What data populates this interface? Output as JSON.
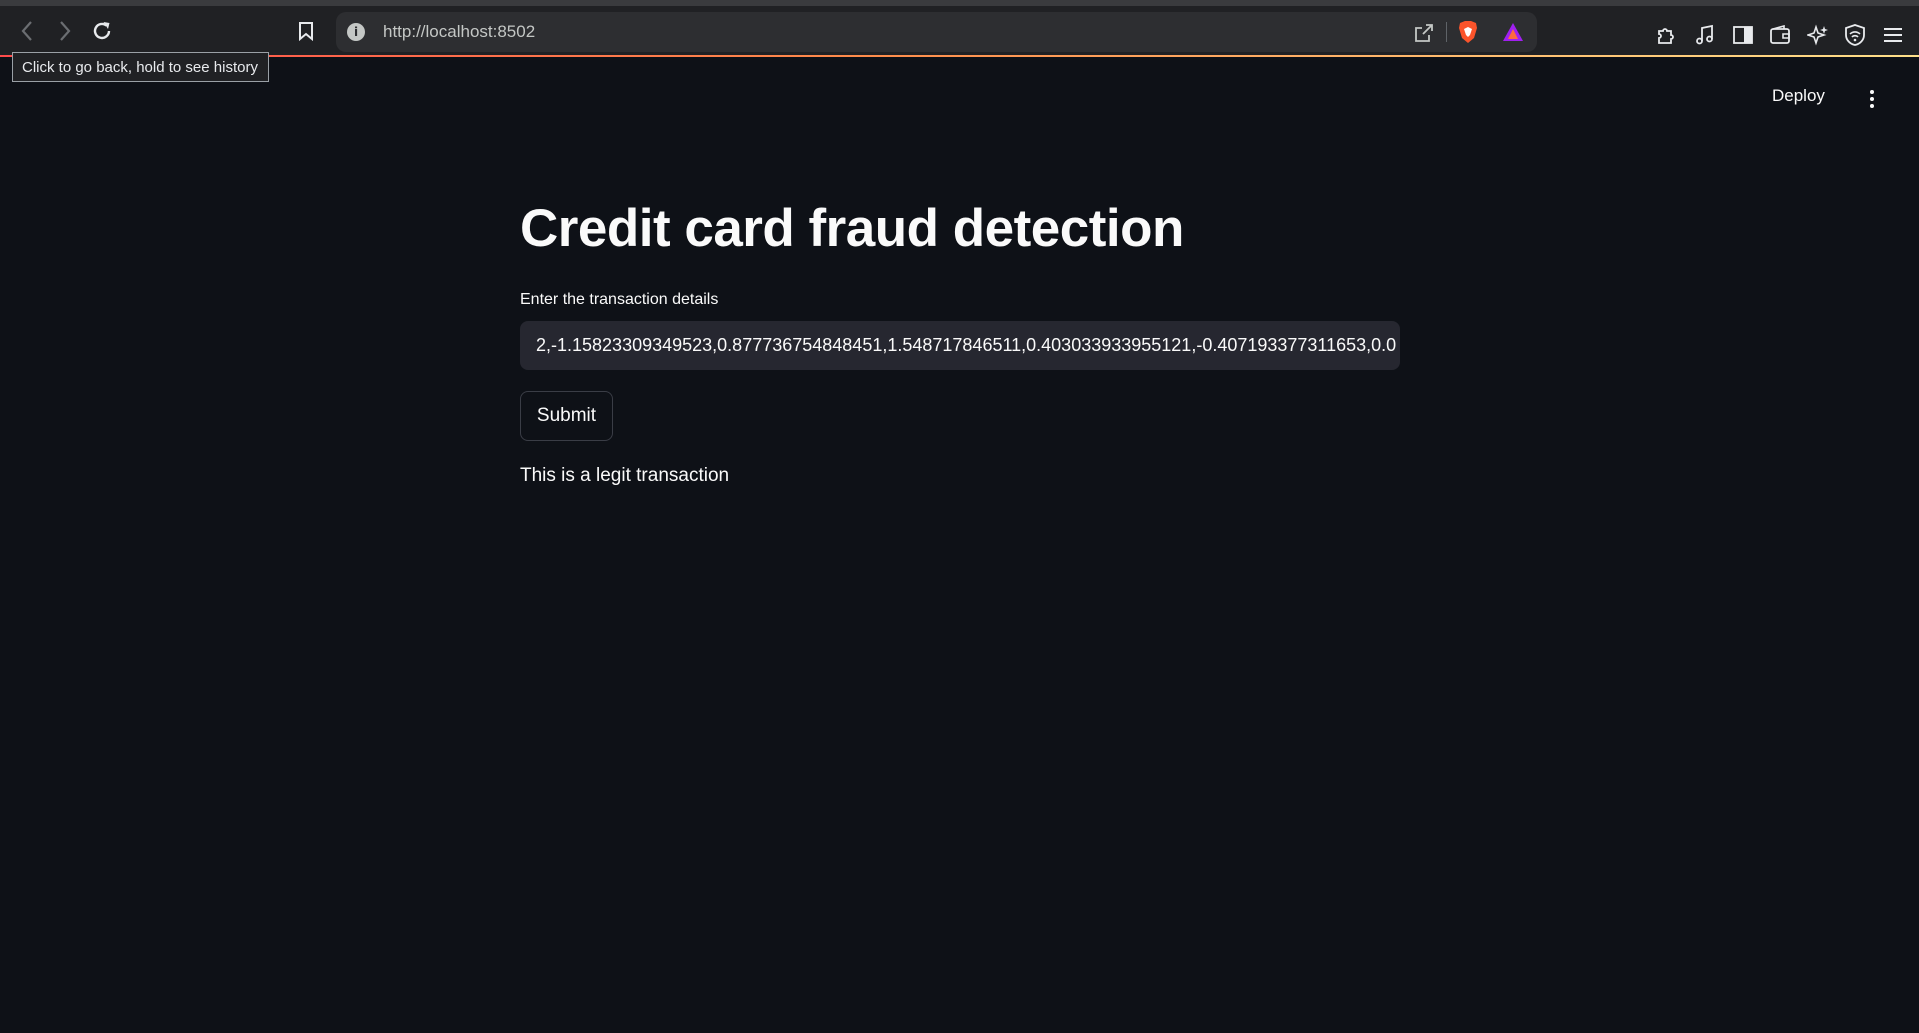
{
  "browser": {
    "url": "http://localhost:8502",
    "back_tooltip": "Click to go back, hold to see history"
  },
  "app_header": {
    "deploy_label": "Deploy"
  },
  "main": {
    "title": "Credit card fraud detection",
    "input_label": "Enter the transaction details",
    "input_value": "2,-1.15823309349523,0.877736754848451,1.548717846511,0.403033933955121,-0.407193377311653,0.0",
    "submit_label": "Submit",
    "result_text": "This is a legit transaction"
  },
  "colors": {
    "background": "#0e1117",
    "input_background": "#262730",
    "text": "#fafafa",
    "brand_accent": "#ff4b4b"
  },
  "icons": [
    "back-icon",
    "forward-icon",
    "reload-icon",
    "bookmark-icon",
    "site-info-icon",
    "share-icon",
    "brave-shields-icon",
    "brave-rewards-icon",
    "extensions-icon",
    "media-icon",
    "sidebar-icon",
    "wallet-icon",
    "leo-ai-icon",
    "vpn-icon",
    "menu-icon",
    "more-options-icon"
  ]
}
